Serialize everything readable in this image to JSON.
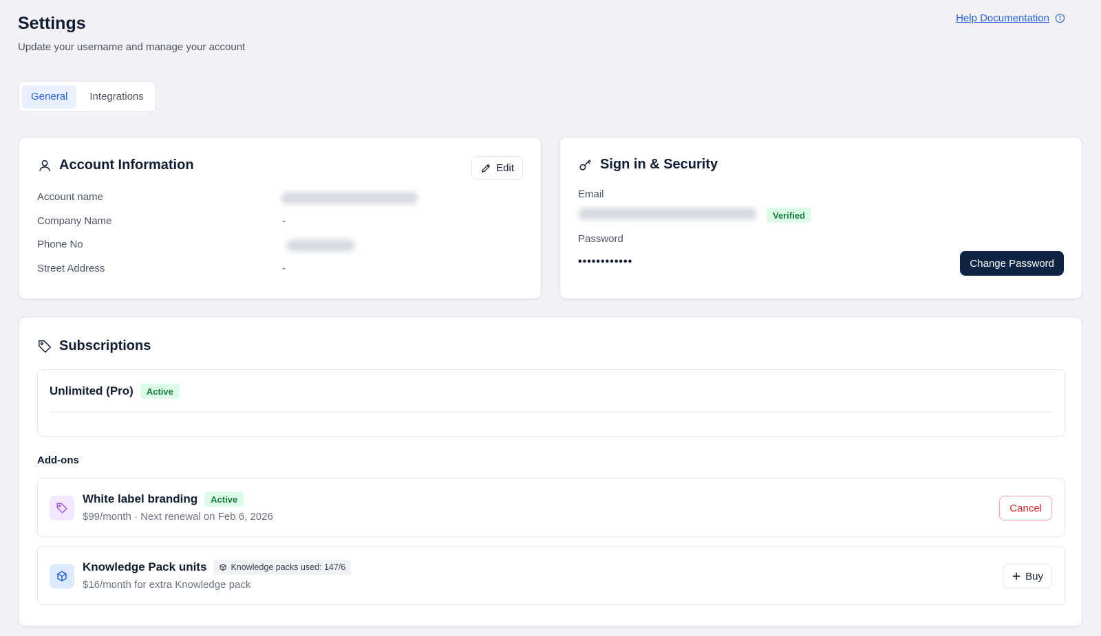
{
  "header": {
    "title": "Settings",
    "subtitle": "Update your username and manage your account",
    "help_link": "Help Documentation",
    "help_icon": "info-icon"
  },
  "tabs": [
    {
      "label": "General",
      "active": true
    },
    {
      "label": "Integrations",
      "active": false
    }
  ],
  "account": {
    "title": "Account Information",
    "icon": "user-icon",
    "edit_label": "Edit",
    "fields": [
      {
        "label": "Account name",
        "value": "",
        "redacted": true
      },
      {
        "label": "Company Name",
        "value": "-",
        "redacted": false
      },
      {
        "label": "Phone No",
        "value": "",
        "redacted": true
      },
      {
        "label": "Street Address",
        "value": "-",
        "redacted": false
      }
    ]
  },
  "security": {
    "title": "Sign in & Security",
    "icon": "key-icon",
    "email_label": "Email",
    "email_value": "",
    "email_redacted": true,
    "verified_label": "Verified",
    "password_label": "Password",
    "password_value": "••••••••••••",
    "change_password_label": "Change Password"
  },
  "subscriptions": {
    "title": "Subscriptions",
    "icon": "tag-icon",
    "plan": {
      "name": "Unlimited (Pro)",
      "status": "Active"
    },
    "addons_label": "Add-ons",
    "addons": [
      {
        "name": "White label branding",
        "status": "Active",
        "subtitle": "$99/month  · Next renewal on Feb 6, 2026",
        "icon": "tag-icon",
        "action_label": "Cancel"
      },
      {
        "name": "Knowledge Pack units",
        "usage": "Knowledge packs used: 147/6",
        "subtitle": "$16/month for extra Knowledge pack",
        "icon": "cube-icon",
        "action_label": "Buy"
      }
    ]
  },
  "colors": {
    "background": "#f3f0f6",
    "accent": "#2563eb",
    "primary_button": "#0f2444",
    "success": "#15803d",
    "danger": "#dc2626"
  }
}
